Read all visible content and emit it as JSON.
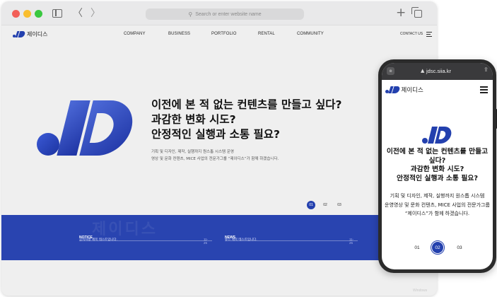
{
  "browser": {
    "address_placeholder": "Search or enter website name",
    "nav_back": "〈",
    "nav_forward": "〉",
    "new_tab": "+"
  },
  "site": {
    "logo_text": "제이디스",
    "nav": [
      "COMPANY",
      "BUSINESS",
      "PORTFOLIO",
      "RENTAL",
      "COMMUNITY"
    ],
    "contact": "CONTACT US",
    "hero": {
      "title_lines": [
        "이전에 본 적 없는 컨텐츠를 만들고 싶다?",
        "과감한 변화 시도?",
        "안정적인 실행과 소통 필요?"
      ],
      "desc_lines": [
        "기획 및 디자인, 제작, 실행까지 원스톱 시스템 운영",
        "영상 및 문화 컨텐츠, MICE 사업의 전문가그룹 “제이디스”가 함께 하겠습니다."
      ]
    },
    "pager": [
      "01",
      "02",
      "03"
    ],
    "band": {
      "watermark": "제이디스",
      "notice_label": "NOTICE",
      "notice_text": "공지사항 제목 테스트입니다.",
      "notice_date": "11-25",
      "news_label": "NEWS",
      "news_text": "뉴스 제목 테스트입니다.",
      "news_date": "11-25"
    },
    "windows_mark": "Windows"
  },
  "mobile": {
    "url": "jdsc.siia.kr",
    "logo_text": "제이디스",
    "title_lines": [
      "이전에 본 적 없는 컨텐츠를 만들고",
      "싶다?",
      "과감한 변화 시도?",
      "안정적인 실행과 소통 필요?"
    ],
    "desc_lines": [
      "기획 및 디자인, 제작, 실행까지 원스톱 시스템",
      "운영영상 및 문화 컨텐츠, MICE 사업의 전문가그룹",
      "“제이디스”가 함께 하겠습니다."
    ],
    "pager": [
      "01",
      "02",
      "03"
    ]
  },
  "colors": {
    "brand_blue": "#2340ae",
    "band_blue": "#2944b0"
  }
}
